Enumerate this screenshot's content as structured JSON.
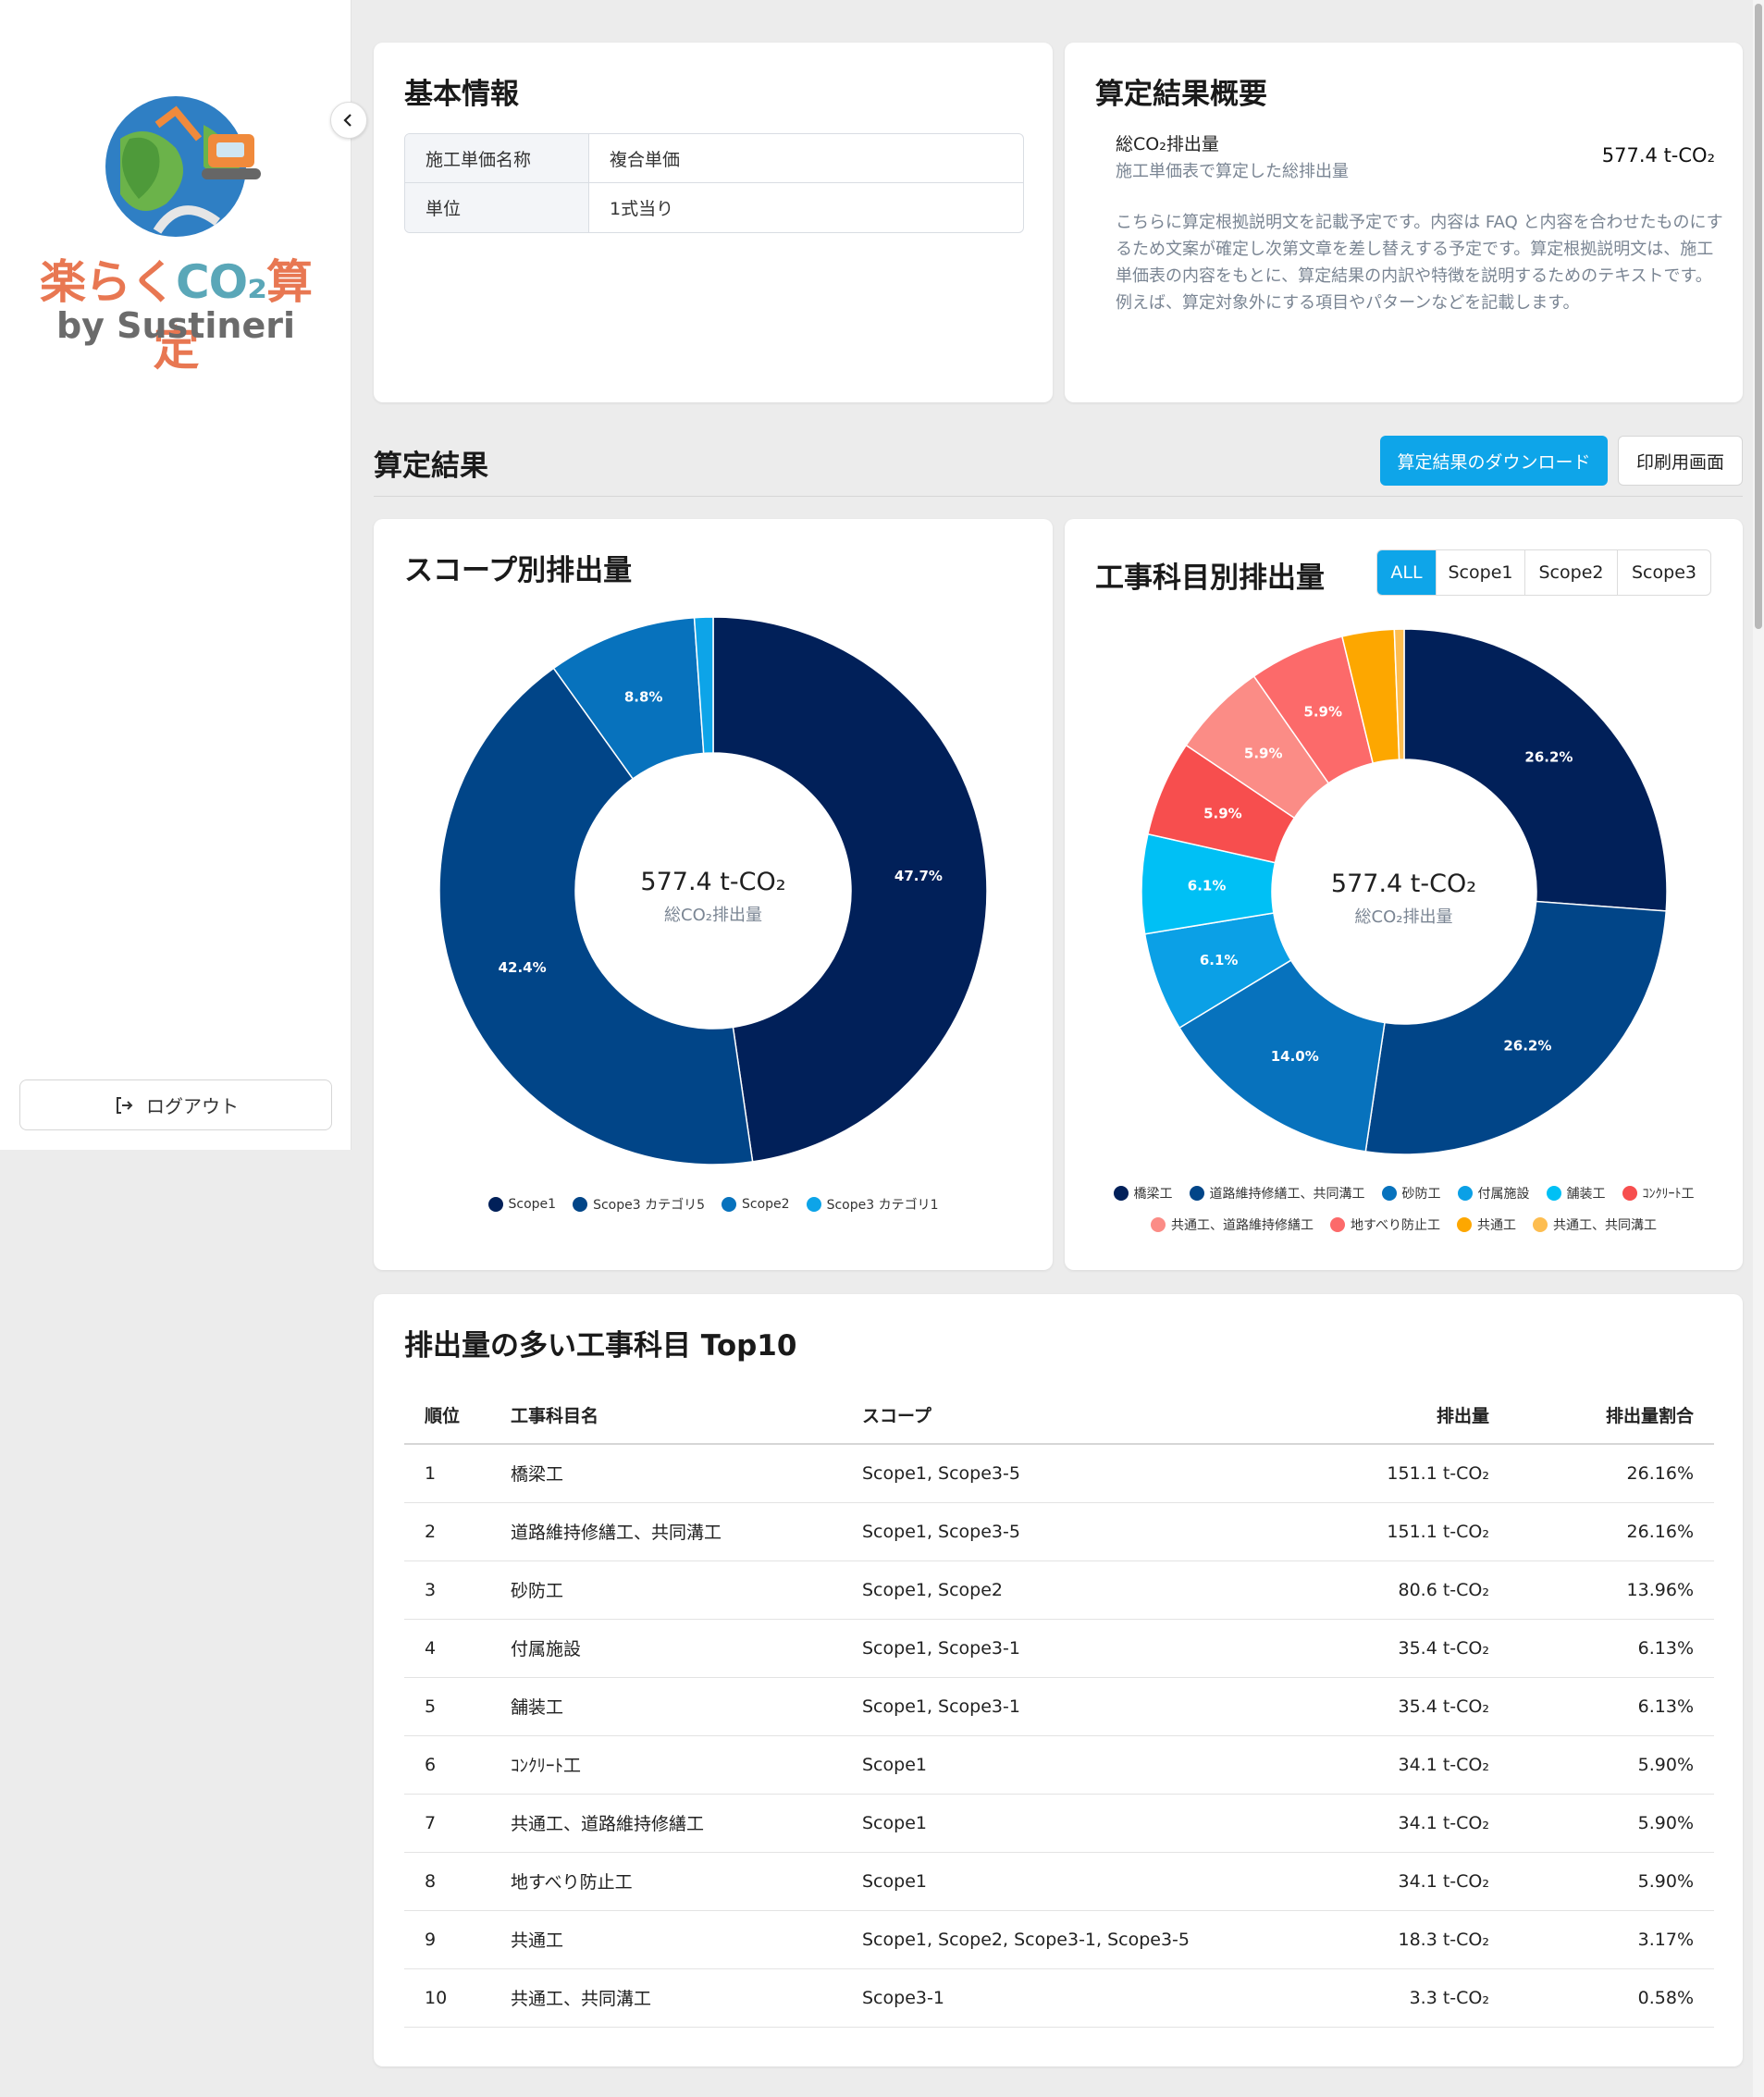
{
  "sidebar": {
    "logo_title_a": "楽らく",
    "logo_title_b": "CO₂",
    "logo_title_c": "算定",
    "logo_sub": "by Sustineri",
    "logout_label": "ログアウト"
  },
  "basic_info": {
    "title": "基本情報",
    "rows": [
      {
        "key": "施工単価名称",
        "value": "複合単価"
      },
      {
        "key": "単位",
        "value": "1式当り"
      }
    ]
  },
  "summary": {
    "title": "算定結果概要",
    "total_label": "総CO₂排出量",
    "total_sub": "施工単価表で算定した総排出量",
    "total_value": "577.4 t-CO₂",
    "description": "こちらに算定根拠説明文を記載予定です。内容は FAQ と内容を合わせたものにするため文案が確定し次第文章を差し替えする予定です。算定根拠説明文は、施工単価表の内容をもとに、算定結果の内訳や特徴を説明するためのテキストです。例えば、算定対象外にする項目やパターンなどを記載します。"
  },
  "results": {
    "title": "算定結果",
    "download_label": "算定結果のダウンロード",
    "print_label": "印刷用画面"
  },
  "scope_chart": {
    "title": "スコープ別排出量",
    "center_value": "577.4 t-CO₂",
    "center_label": "総CO₂排出量"
  },
  "item_chart": {
    "title": "工事科目別排出量",
    "filters": [
      "ALL",
      "Scope1",
      "Scope2",
      "Scope3"
    ],
    "center_value": "577.4 t-CO₂",
    "center_label": "総CO₂排出量"
  },
  "chart_data": [
    {
      "type": "pie",
      "title": "スコープ別排出量",
      "categories": [
        "Scope1",
        "Scope3 カテゴリ5",
        "Scope2",
        "Scope3 カテゴリ1"
      ],
      "values": [
        47.7,
        42.4,
        8.8,
        1.1
      ],
      "labels": [
        "47.7%",
        "42.4%",
        "8.8%",
        ""
      ],
      "colors": [
        "#012059",
        "#014588",
        "#0772bd",
        "#0da4e8"
      ]
    },
    {
      "type": "pie",
      "title": "工事科目別排出量",
      "categories": [
        "橋梁工",
        "道路維持修繕工、共同溝工",
        "砂防工",
        "付属施設",
        "舗装工",
        "ｺﾝｸﾘｰﾄ工",
        "共通工、道路維持修繕工",
        "地すべり防止工",
        "共通工",
        "共通工、共同溝工"
      ],
      "values": [
        26.2,
        26.2,
        14.0,
        6.1,
        6.1,
        5.9,
        5.9,
        5.9,
        3.2,
        0.6
      ],
      "labels": [
        "26.2%",
        "26.2%",
        "14.0%",
        "6.1%",
        "6.1%",
        "5.9%",
        "5.9%",
        "5.9%",
        "",
        ""
      ],
      "colors": [
        "#012059",
        "#014588",
        "#0772bd",
        "#0ba0e6",
        "#00c0f5",
        "#f74e4e",
        "#fb8c86",
        "#fc6a6a",
        "#fda700",
        "#fdbd50"
      ]
    }
  ],
  "top10": {
    "title": "排出量の多い工事科目 Top10",
    "headers": [
      "順位",
      "工事科目名",
      "スコープ",
      "排出量",
      "排出量割合"
    ],
    "rows": [
      [
        "1",
        "橋梁工",
        "Scope1, Scope3-5",
        "151.1 t-CO₂",
        "26.16%"
      ],
      [
        "2",
        "道路維持修繕工、共同溝工",
        "Scope1, Scope3-5",
        "151.1 t-CO₂",
        "26.16%"
      ],
      [
        "3",
        "砂防工",
        "Scope1, Scope2",
        "80.6 t-CO₂",
        "13.96%"
      ],
      [
        "4",
        "付属施設",
        "Scope1, Scope3-1",
        "35.4 t-CO₂",
        "6.13%"
      ],
      [
        "5",
        "舗装工",
        "Scope1, Scope3-1",
        "35.4 t-CO₂",
        "6.13%"
      ],
      [
        "6",
        "ｺﾝｸﾘｰﾄ工",
        "Scope1",
        "34.1 t-CO₂",
        "5.90%"
      ],
      [
        "7",
        "共通工、道路維持修繕工",
        "Scope1",
        "34.1 t-CO₂",
        "5.90%"
      ],
      [
        "8",
        "地すべり防止工",
        "Scope1",
        "34.1 t-CO₂",
        "5.90%"
      ],
      [
        "9",
        "共通工",
        "Scope1, Scope2, Scope3-1, Scope3-5",
        "18.3 t-CO₂",
        "3.17%"
      ],
      [
        "10",
        "共通工、共同溝工",
        "Scope3-1",
        "3.3 t-CO₂",
        "0.58%"
      ]
    ]
  }
}
